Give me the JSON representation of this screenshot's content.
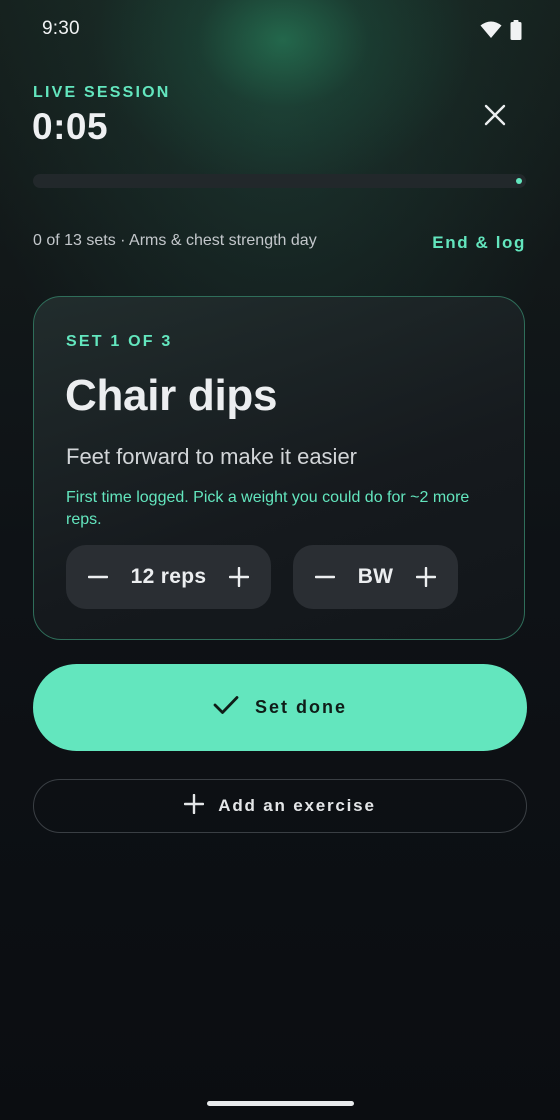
{
  "status_bar": {
    "time": "9:30",
    "icons": [
      "wifi-icon",
      "battery-icon"
    ]
  },
  "header": {
    "live_label": "LIVE SESSION",
    "timer": "0:05",
    "close_icon": "close-icon",
    "progress_fraction": 0
  },
  "session": {
    "sets_info": "0 of 13 sets · Arms & chest strength day",
    "end_log_label": "End & log"
  },
  "card": {
    "set_label": "SET 1 OF 3",
    "exercise_name": "Chair dips",
    "tip": "Feet forward to make it easier",
    "first_time_note": "First time logged. Pick a weight you could do for ~2 more reps.",
    "reps_value": "12 reps",
    "weight_value": "BW"
  },
  "actions": {
    "set_done_label": "Set done",
    "add_exercise_label": "Add an exercise"
  },
  "colors": {
    "accent": "#63e6be",
    "background": "#0c0f13",
    "card_border": "#2f6e5a",
    "stepper_bg": "#2a2e33"
  }
}
